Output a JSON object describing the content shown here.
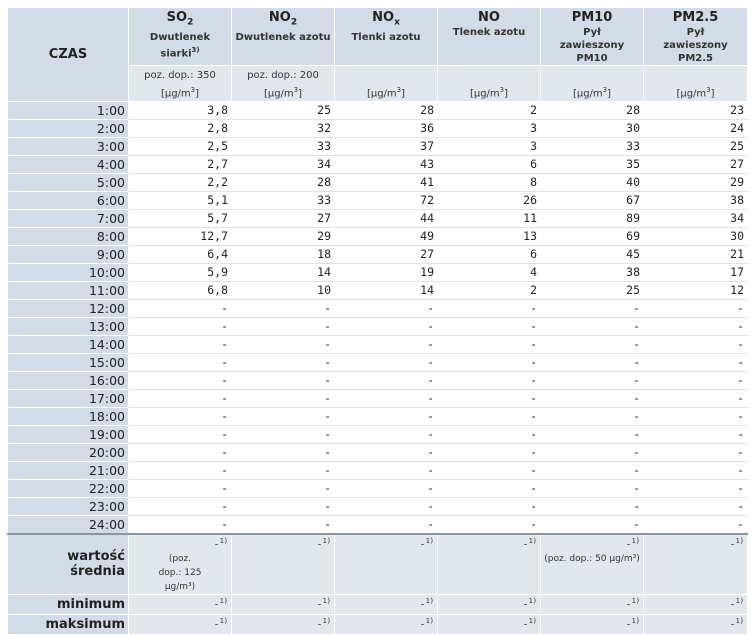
{
  "time_header": "CZAS",
  "columns": [
    {
      "name": "SO",
      "sub": "2",
      "desc": "Dwutlenek siarki",
      "desc_sup": "3)",
      "dop": "poz. dop.: 350",
      "unit": "[µg/m",
      "unit_sup": "3",
      "unit_end": "]"
    },
    {
      "name": "NO",
      "sub": "2",
      "desc": "Dwutlenek azotu",
      "desc_sup": "",
      "dop": "poz. dop.: 200",
      "unit": "[µg/m",
      "unit_sup": "3",
      "unit_end": "]"
    },
    {
      "name": "NO",
      "sub": "x",
      "desc": "Tlenki azotu",
      "desc_sup": "",
      "dop": "",
      "unit": "[µg/m",
      "unit_sup": "3",
      "unit_end": "]"
    },
    {
      "name": "NO",
      "sub": "",
      "desc": "Tlenek azotu",
      "desc_sup": "",
      "dop": "",
      "unit": "[µg/m",
      "unit_sup": "3",
      "unit_end": "]"
    },
    {
      "name": "PM10",
      "sub": "",
      "desc": "Pył zawieszony PM10",
      "desc_sup": "",
      "dop": "",
      "unit": "[µg/m",
      "unit_sup": "3",
      "unit_end": "]"
    },
    {
      "name": "PM2.5",
      "sub": "",
      "desc": "Pył zawieszony PM2.5",
      "desc_sup": "",
      "dop": "",
      "unit": "[µg/m",
      "unit_sup": "3",
      "unit_end": "]"
    }
  ],
  "rows": [
    {
      "time": "1:00",
      "values": [
        "3,8",
        "25",
        "28",
        "2",
        "28",
        "23"
      ]
    },
    {
      "time": "2:00",
      "values": [
        "2,8",
        "32",
        "36",
        "3",
        "30",
        "24"
      ]
    },
    {
      "time": "3:00",
      "values": [
        "2,5",
        "33",
        "37",
        "3",
        "33",
        "25"
      ]
    },
    {
      "time": "4:00",
      "values": [
        "2,7",
        "34",
        "43",
        "6",
        "35",
        "27"
      ]
    },
    {
      "time": "5:00",
      "values": [
        "2,2",
        "28",
        "41",
        "8",
        "40",
        "29"
      ]
    },
    {
      "time": "6:00",
      "values": [
        "5,1",
        "33",
        "72",
        "26",
        "67",
        "38"
      ]
    },
    {
      "time": "7:00",
      "values": [
        "5,7",
        "27",
        "44",
        "11",
        "89",
        "34"
      ]
    },
    {
      "time": "8:00",
      "values": [
        "12,7",
        "29",
        "49",
        "13",
        "69",
        "30"
      ]
    },
    {
      "time": "9:00",
      "values": [
        "6,4",
        "18",
        "27",
        "6",
        "45",
        "21"
      ]
    },
    {
      "time": "10:00",
      "values": [
        "5,9",
        "14",
        "19",
        "4",
        "38",
        "17"
      ]
    },
    {
      "time": "11:00",
      "values": [
        "6,8",
        "10",
        "14",
        "2",
        "25",
        "12"
      ]
    },
    {
      "time": "12:00",
      "values": [
        "-",
        "-",
        "-",
        "-",
        "-",
        "-"
      ]
    },
    {
      "time": "13:00",
      "values": [
        "-",
        "-",
        "-",
        "-",
        "-",
        "-"
      ]
    },
    {
      "time": "14:00",
      "values": [
        "-",
        "-",
        "-",
        "-",
        "-",
        "-"
      ]
    },
    {
      "time": "15:00",
      "values": [
        "-",
        "-",
        "-",
        "-",
        "-",
        "-"
      ]
    },
    {
      "time": "16:00",
      "values": [
        "-",
        "-",
        "-",
        "-",
        "-",
        "-"
      ]
    },
    {
      "time": "17:00",
      "values": [
        "-",
        "-",
        "-",
        "-",
        "-",
        "-"
      ]
    },
    {
      "time": "18:00",
      "values": [
        "-",
        "-",
        "-",
        "-",
        "-",
        "-"
      ]
    },
    {
      "time": "19:00",
      "values": [
        "-",
        "-",
        "-",
        "-",
        "-",
        "-"
      ]
    },
    {
      "time": "20:00",
      "values": [
        "-",
        "-",
        "-",
        "-",
        "-",
        "-"
      ]
    },
    {
      "time": "21:00",
      "values": [
        "-",
        "-",
        "-",
        "-",
        "-",
        "-"
      ]
    },
    {
      "time": "22:00",
      "values": [
        "-",
        "-",
        "-",
        "-",
        "-",
        "-"
      ]
    },
    {
      "time": "23:00",
      "values": [
        "-",
        "-",
        "-",
        "-",
        "-",
        "-"
      ]
    },
    {
      "time": "24:00",
      "values": [
        "-",
        "-",
        "-",
        "-",
        "-",
        "-"
      ]
    }
  ],
  "stats": [
    {
      "label": "wartość średnia",
      "values": [
        "-",
        "-",
        "-",
        "-",
        "-",
        "-"
      ],
      "sup": "1)",
      "notes": [
        "(poz. dop.: 125 µg/m³)",
        "",
        "",
        "",
        "(poz. dop.: 50 µg/m³)",
        ""
      ]
    },
    {
      "label": "minimum",
      "values": [
        "-",
        "-",
        "-",
        "-",
        "-",
        "-"
      ],
      "sup": "1)",
      "notes": [
        "",
        "",
        "",
        "",
        "",
        ""
      ]
    },
    {
      "label": "maksimum",
      "values": [
        "-",
        "-",
        "-",
        "-",
        "-",
        "-"
      ],
      "sup": "1)",
      "notes": [
        "",
        "",
        "",
        "",
        "",
        ""
      ]
    }
  ],
  "colors": {
    "header_bg": "#d3dbe6",
    "stat_bg": "#e2e7ee",
    "separator": "#8b96a3"
  }
}
